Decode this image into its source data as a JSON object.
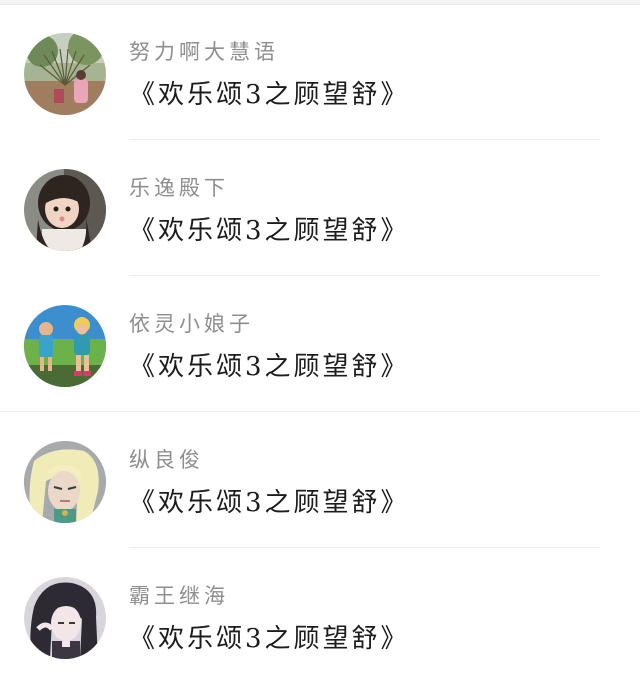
{
  "items": [
    {
      "name": "努力啊大慧语",
      "title": "《欢乐颂3之顾望舒》",
      "avatar": "avatar-photo-peacock"
    },
    {
      "name": "乐逸殿下",
      "title": "《欢乐颂3之顾望舒》",
      "avatar": "avatar-photo-girl"
    },
    {
      "name": "依灵小娘子",
      "title": "《欢乐颂3之顾望舒》",
      "avatar": "avatar-photo-figurines"
    },
    {
      "name": "纵良俊",
      "title": "《欢乐颂3之顾望舒》",
      "avatar": "avatar-anime-blonde"
    },
    {
      "name": "霸王继海",
      "title": "《欢乐颂3之顾望舒》",
      "avatar": "avatar-anime-dark-hair"
    }
  ]
}
